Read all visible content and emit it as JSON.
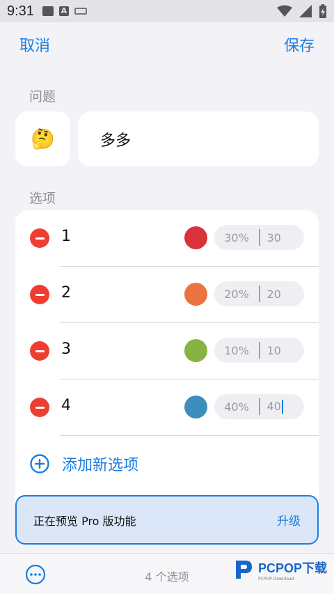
{
  "status_bar": {
    "time": "9:31"
  },
  "nav": {
    "cancel": "取消",
    "save": "保存"
  },
  "question": {
    "label": "问题",
    "emoji": "🤔",
    "text": "多多"
  },
  "options": {
    "label": "选项",
    "items": [
      {
        "label": "1",
        "color": "#d9323a",
        "percent": "30%",
        "value": "30"
      },
      {
        "label": "2",
        "color": "#ec7340",
        "percent": "20%",
        "value": "20"
      },
      {
        "label": "3",
        "color": "#86b343",
        "percent": "10%",
        "value": "10"
      },
      {
        "label": "4",
        "color": "#3e8ebd",
        "percent": "40%",
        "value": "40"
      }
    ],
    "add_label": "添加新选项"
  },
  "pro_banner": {
    "text": "正在预览 Pro 版功能",
    "upgrade": "升级"
  },
  "bottom": {
    "count": "4 个选项"
  },
  "watermark": {
    "brand": "PCPOP下载",
    "sub": "PCPOP Download"
  },
  "colors": {
    "accent": "#1a7de0",
    "danger": "#ee3e32"
  }
}
